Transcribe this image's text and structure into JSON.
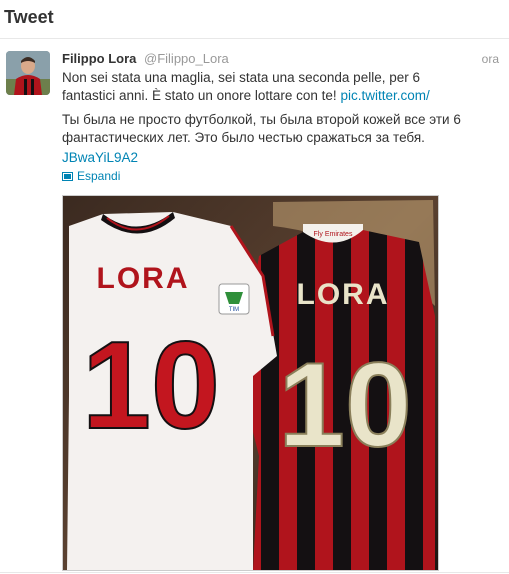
{
  "header": {
    "title": "Tweet"
  },
  "tweet": {
    "fullname": "Filippo Lora",
    "screenname": "@Filippo_Lora",
    "time": "ora",
    "text_it": "Non sei stata una maglia, sei stata una seconda pelle, per 6 fantastici anni. È stato un onore lottare con te!",
    "link_1": "pic.twitter.com/",
    "text_ru": "Ты была не просто футболкой, ты была второй кожей все эти 6 фантастических лет. Это было честью сражаться за тебя.",
    "link_2": "JBwaYiL9A2",
    "expand_label": "Espandi",
    "photo": {
      "left_shirt_name": "LORA",
      "left_shirt_number": "10",
      "right_shirt_name": "LORA",
      "right_shirt_number": "10",
      "collar_text": "Fly Emirates",
      "badge_text": "TIM"
    }
  },
  "colors": {
    "link": "#0084b4",
    "muted": "#999999",
    "text": "#333333",
    "milan_red": "#b0141c",
    "milan_black": "#141012"
  }
}
